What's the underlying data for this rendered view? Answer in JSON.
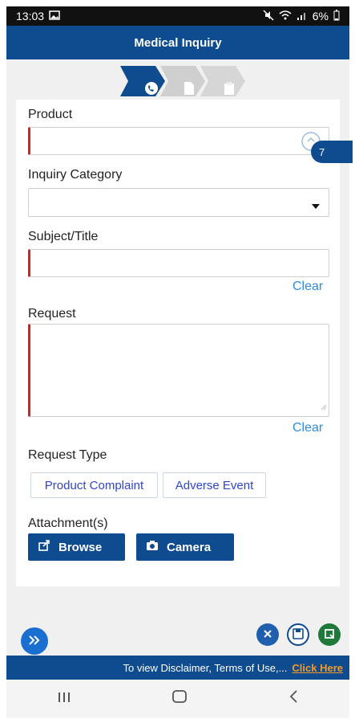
{
  "status_bar": {
    "time": "13:03",
    "battery": "6%"
  },
  "header": {
    "title": "Medical Inquiry"
  },
  "badge": {
    "count": "7"
  },
  "form": {
    "product_label": "Product",
    "category_label": "Inquiry Category",
    "subject_label": "Subject/Title",
    "subject_clear": "Clear",
    "request_label": "Request",
    "request_clear": "Clear",
    "request_type_label": "Request Type",
    "request_types": [
      "Product Complaint",
      "Adverse Event"
    ],
    "attachments_label": "Attachment(s)",
    "browse_label": "Browse",
    "camera_label": "Camera"
  },
  "footer": {
    "disclaimer_text": "To view Disclaimer, Terms of Use,...",
    "disclaimer_link": "Click Here"
  },
  "colors": {
    "brand": "#0f4b8f",
    "required": "#d42020",
    "link": "#2f8ce0",
    "accent": "#f39a22"
  }
}
